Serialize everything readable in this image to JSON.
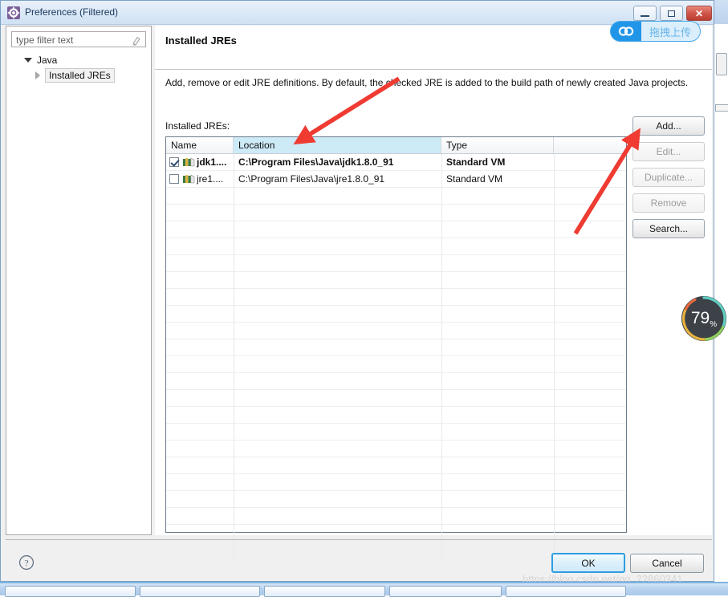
{
  "window": {
    "title": "Preferences (Filtered)",
    "icon": "gear-icon",
    "minimize_label": "Minimize",
    "maximize_label": "Maximize",
    "close_label": "Close"
  },
  "sidebar": {
    "filter": {
      "placeholder": "type filter text",
      "value": ""
    },
    "tree": [
      {
        "label": "Java",
        "expanded": true
      },
      {
        "label": "Installed JREs",
        "expanded": false,
        "selected": true
      }
    ]
  },
  "main": {
    "title": "Installed JREs",
    "description": "Add, remove or edit JRE definitions. By default, the checked JRE is added to the build path of newly created Java projects.",
    "list_label": "Installed JREs:",
    "table": {
      "columns": [
        "Name",
        "Location",
        "Type",
        ""
      ],
      "selected_column": "Location",
      "rows": [
        {
          "checked": true,
          "name": "jdk1....",
          "location": "C:\\Program Files\\Java\\jdk1.8.0_91",
          "type": "Standard VM",
          "bold": true
        },
        {
          "checked": false,
          "name": "jre1....",
          "location": "C:\\Program Files\\Java\\jre1.8.0_91",
          "type": "Standard VM",
          "bold": false
        }
      ],
      "empty_row_count": 22
    },
    "buttons": [
      {
        "label": "Add...",
        "enabled": true
      },
      {
        "label": "Edit...",
        "enabled": false
      },
      {
        "label": "Duplicate...",
        "enabled": false
      },
      {
        "label": "Remove",
        "enabled": false
      },
      {
        "label": "Search...",
        "enabled": true
      }
    ]
  },
  "footer": {
    "help_label": "?",
    "ok_label": "OK",
    "cancel_label": "Cancel"
  },
  "overlays": {
    "upload_widget": {
      "text": "拖拽上传",
      "icon": "cloud-upload-icon",
      "accent": "#2196e8"
    },
    "progress": {
      "value": "79",
      "unit": "%",
      "background": "#3d4249"
    },
    "watermark": "https://blog.csdn.net/qq_22860341"
  },
  "annotations": [
    {
      "name": "arrow-to-location-cell",
      "color": "#ef3b32"
    },
    {
      "name": "arrow-to-add-button",
      "color": "#ef3b32"
    }
  ]
}
